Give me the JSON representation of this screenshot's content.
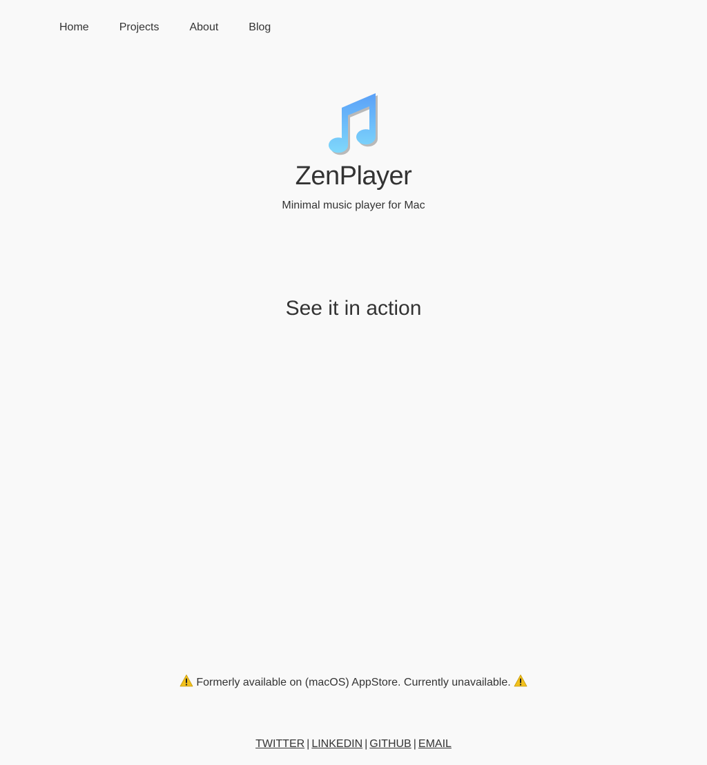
{
  "nav": {
    "items": [
      {
        "label": "Home"
      },
      {
        "label": "Projects"
      },
      {
        "label": "About"
      },
      {
        "label": "Blog"
      }
    ]
  },
  "hero": {
    "icon": "music-note-icon",
    "title": "ZenPlayer",
    "subtitle": "Minimal music player for Mac"
  },
  "section": {
    "title": "See it in action"
  },
  "notice": {
    "icon": "warning-icon",
    "text": "Formerly available on (macOS) AppStore. Currently unavailable."
  },
  "footer": {
    "links": [
      {
        "label": "TWITTER"
      },
      {
        "label": "LINKEDIN"
      },
      {
        "label": "GITHUB"
      },
      {
        "label": "EMAIL"
      }
    ],
    "separator": "|"
  },
  "colors": {
    "background": "#f9f9f9",
    "text": "#333333",
    "icon_gradient_top": "#5aa0f8",
    "icon_gradient_bottom": "#7fd8fb",
    "warning_yellow": "#f2c11c"
  }
}
